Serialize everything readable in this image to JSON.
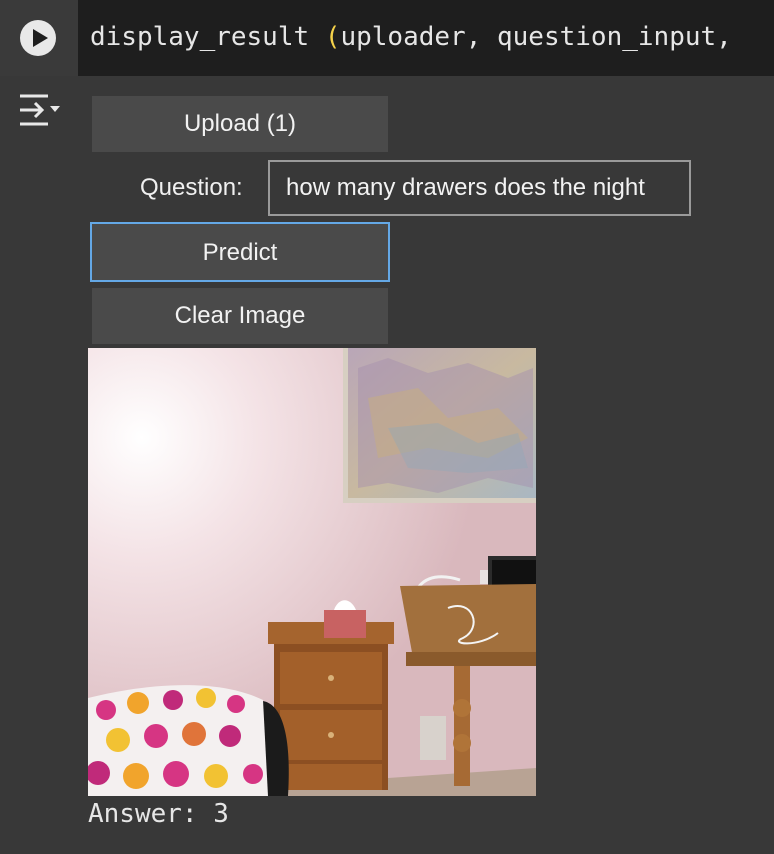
{
  "cell": {
    "code_prefix": "display_result ",
    "code_paren": "(",
    "code_rest": "uploader, question_input,"
  },
  "widgets": {
    "upload_label": "Upload (1)",
    "question_label": "Question:",
    "question_value": "how many drawers does the night",
    "predict_label": "Predict",
    "clear_label": "Clear Image"
  },
  "image": {
    "description_icon": "bedroom-photo"
  },
  "output": {
    "answer_label": "Answer:",
    "answer_value": "3",
    "answer_text": "Answer: 3"
  },
  "colors": {
    "background": "#383838",
    "cell_header": "#1e1e1e",
    "button_bg": "#4a4a4a",
    "focus_border": "#64a8e6",
    "paren": "#f5d24a"
  }
}
